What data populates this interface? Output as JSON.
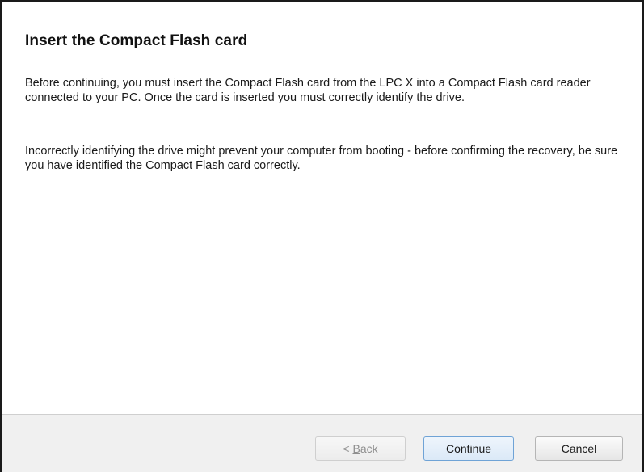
{
  "page": {
    "title": "Insert the Compact Flash card",
    "paragraph1": "Before continuing, you must insert the Compact Flash card from the LPC X into a Compact Flash card reader connected to your PC. Once the card is inserted you must correctly identify the drive.",
    "paragraph2": "Incorrectly identifying the drive might prevent your computer from booting - before confirming the recovery, be sure you have identified the Compact Flash card correctly."
  },
  "buttons": {
    "back_prefix": "< ",
    "back_mnemonic": "B",
    "back_rest": "ack",
    "back_enabled": false,
    "continue_label": "Continue",
    "cancel_label": "Cancel"
  },
  "colors": {
    "border": "#1a1a1a",
    "footer_bg": "#f0f0f0",
    "default_button_border": "#6fa3d6"
  }
}
